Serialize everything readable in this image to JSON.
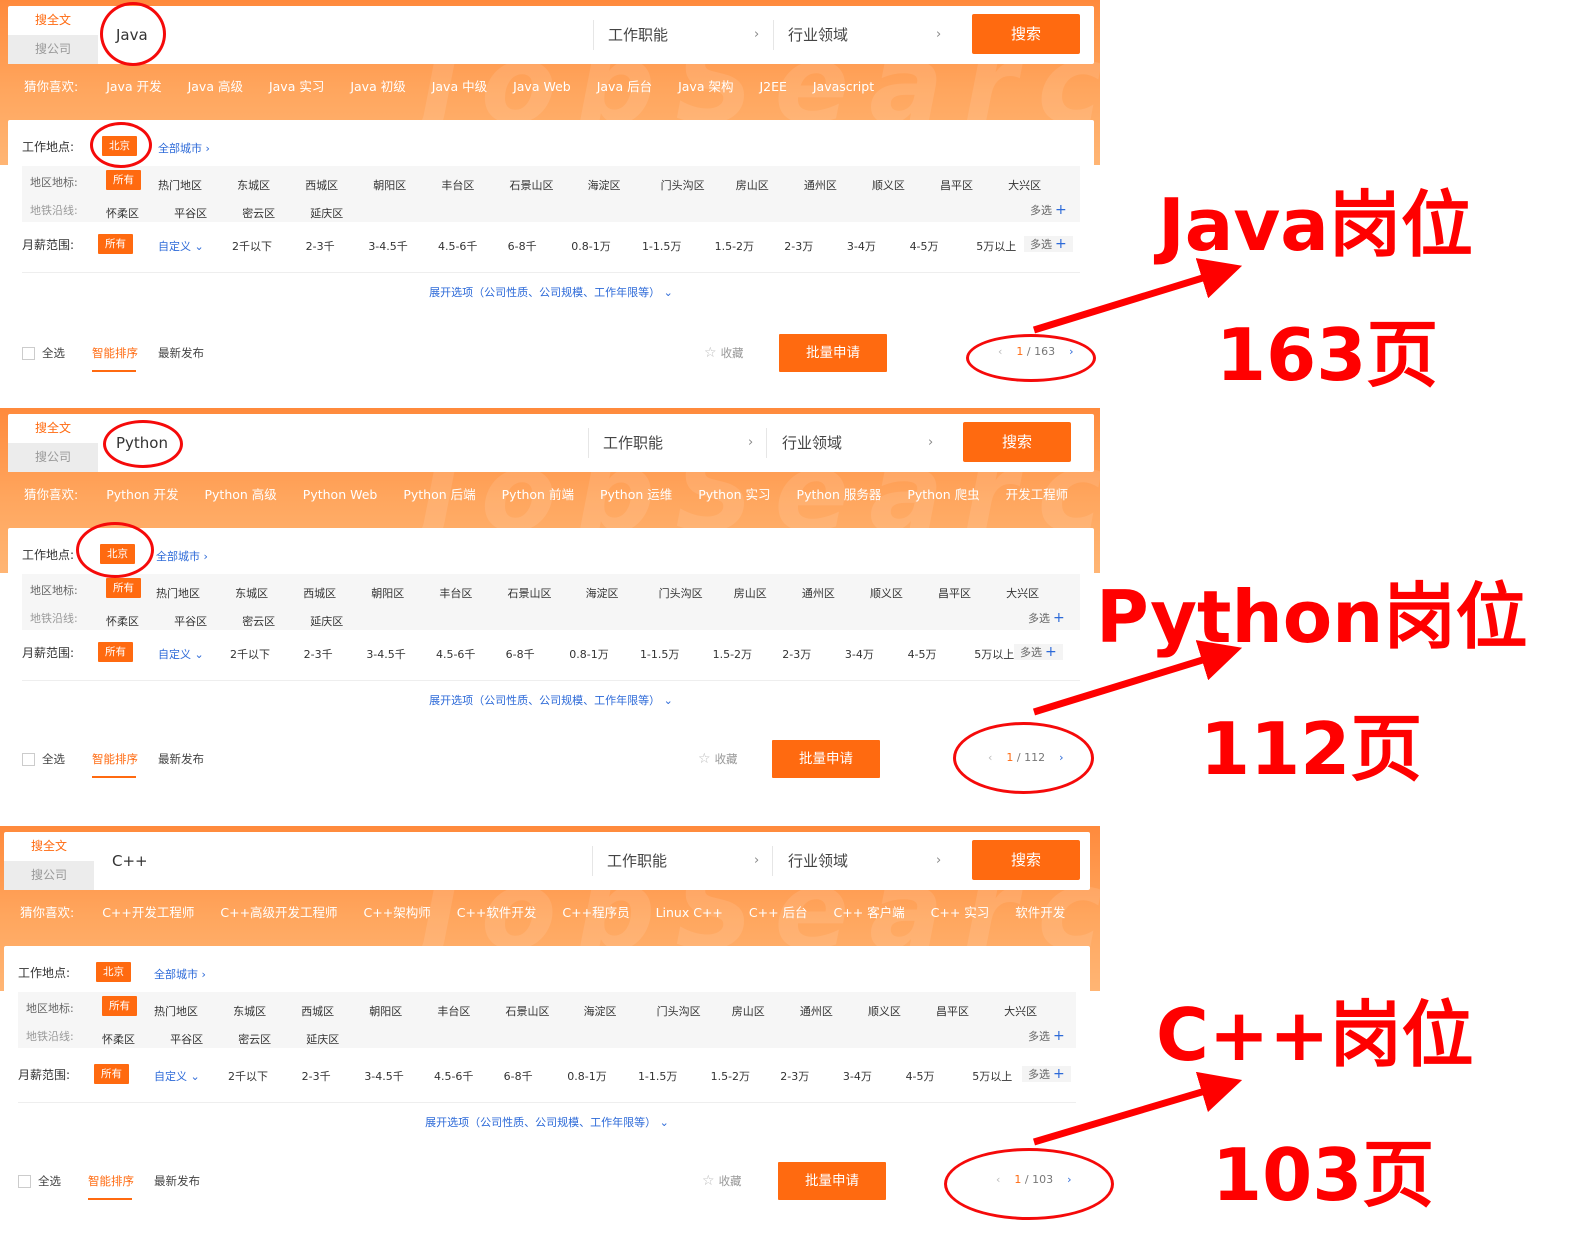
{
  "common": {
    "tab_fulltext": "搜全文",
    "tab_company": "搜公司",
    "job_function": "工作职能",
    "industry": "行业领域",
    "search_btn": "搜索",
    "guess_label": "猜你喜欢:",
    "location_label": "工作地点:",
    "city_selected": "北京",
    "all_cities": "全部城市",
    "area_label": "地区地标:",
    "metro_label": "地铁沿线:",
    "all_tag": "所有",
    "districts": [
      "热门地区",
      "东城区",
      "西城区",
      "朝阳区",
      "丰台区",
      "石景山区",
      "海淀区",
      "门头沟区",
      "房山区",
      "通州区",
      "顺义区",
      "昌平区",
      "大兴区"
    ],
    "districts2": [
      "怀柔区",
      "平谷区",
      "密云区",
      "延庆区"
    ],
    "multi_select": "多选",
    "salary_label": "月薪范围:",
    "custom": "自定义",
    "salaries": [
      "2千以下",
      "2-3千",
      "3-4.5千",
      "4.5-6千",
      "6-8千",
      "0.8-1万",
      "1-1.5万",
      "1.5-2万",
      "2-3万",
      "3-4万",
      "4-5万",
      "5万以上"
    ],
    "expand": "展开选项（公司性质、公司规模、工作年限等）",
    "select_all": "全选",
    "sort_smart": "智能排序",
    "sort_new": "最新发布",
    "favorite": "收藏",
    "batch_apply": "批量申请",
    "accent_color": "#ff6a10"
  },
  "panels": [
    {
      "keyword": "Java",
      "guesses": [
        "Java 开发",
        "Java 高级",
        "Java 实习",
        "Java 初级",
        "Java 中级",
        "Java Web",
        "Java 后台",
        "Java 架构",
        "J2EE",
        "Javascript"
      ],
      "page_current": "1",
      "page_total": "163",
      "annotation_title": "Java岗位",
      "annotation_pages": "163页"
    },
    {
      "keyword": "Python",
      "guesses": [
        "Python 开发",
        "Python 高级",
        "Python Web",
        "Python 后端",
        "Python 前端",
        "Python 运维",
        "Python 实习",
        "Python 服务器",
        "Python 爬虫",
        "开发工程师"
      ],
      "page_current": "1",
      "page_total": "112",
      "annotation_title": "Python岗位",
      "annotation_pages": "112页"
    },
    {
      "keyword": "C++",
      "guesses": [
        "C++开发工程师",
        "C++高级开发工程师",
        "C++架构师",
        "C++软件开发",
        "C++程序员",
        "Linux C++",
        "C++ 后台",
        "C++ 客户端",
        "C++ 实习",
        "软件开发"
      ],
      "page_current": "1",
      "page_total": "103",
      "annotation_title": "C++岗位",
      "annotation_pages": "103页"
    }
  ]
}
